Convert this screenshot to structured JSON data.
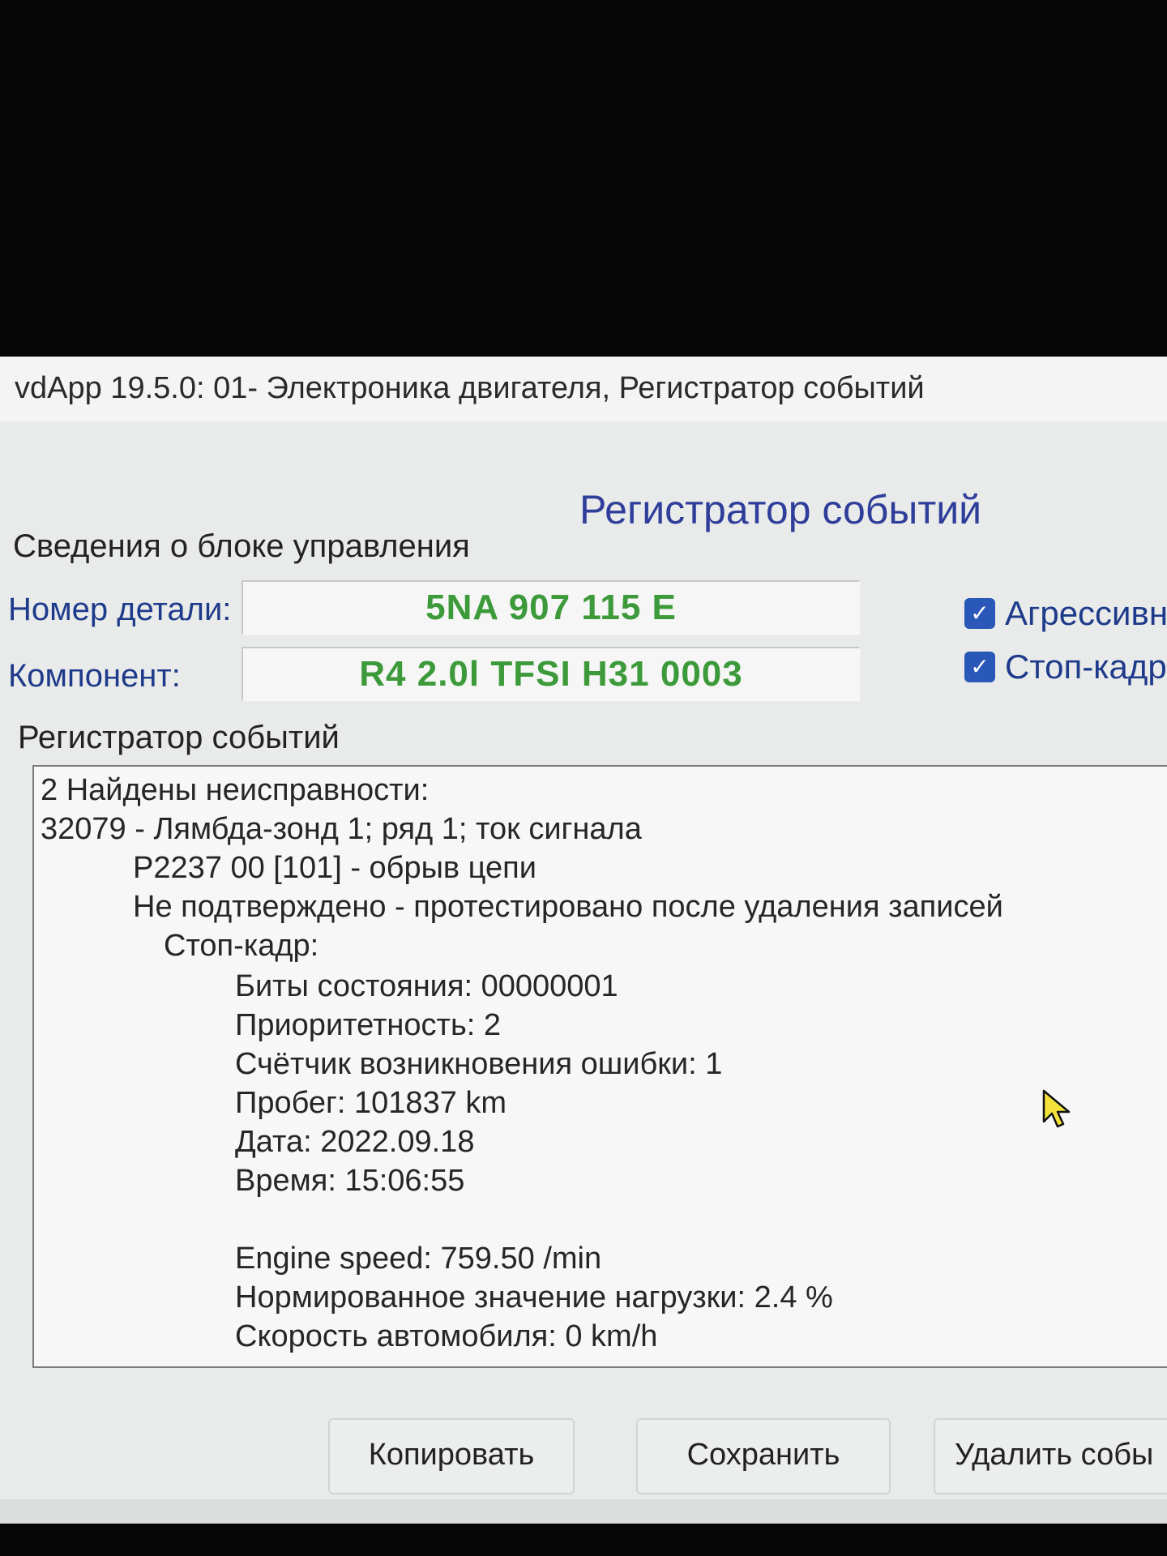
{
  "window": {
    "title": "vdApp 19.5.0: 01- Электроника двигателя,  Регистратор событий"
  },
  "dialog": {
    "heading": "Регистратор событий"
  },
  "ecu_info": {
    "section_label": "Сведения о блоке управления",
    "part_number_label": "Номер детали:",
    "part_number_value": "5NA 907 115 E",
    "component_label": "Компонент:",
    "component_value": "R4 2.0l TFSI  H31 0003"
  },
  "options": {
    "aggressive_label": "Агрессивн",
    "aggressive_checked": true,
    "freeze_frame_label": "Стоп-кадр",
    "freeze_frame_checked": true
  },
  "event_log": {
    "section_label": "Регистратор событий",
    "lines": [
      "2 Найдены неисправности:",
      "32079 - Лямбда-зонд 1; ряд 1; ток сигнала",
      "P2237 00 [101] - обрыв цепи",
      "Не подтверждено - протестировано после удаления записей",
      "Стоп-кадр:",
      "Биты состояния: 00000001",
      "Приоритетность: 2",
      "Счётчик возникновения ошибки: 1",
      "Пробег: 101837 km",
      "Дата: 2022.09.18",
      "Время: 15:06:55",
      "Engine speed: 759.50 /min",
      "Нормированное значение нагрузки: 2.4 %",
      "Скорость автомобиля: 0 km/h"
    ]
  },
  "buttons": {
    "copy_label": "Копировать",
    "save_label": "Сохранить",
    "delete_label": "Удалить собы"
  },
  "icons": {
    "checkbox": "check-icon",
    "cursor": "mouse-cursor-icon"
  },
  "colors": {
    "field_value": "#3d9a3a",
    "label_blue": "#1e3a8a",
    "heading_blue": "#2f3e9a",
    "checkbox_blue": "#2a58b8"
  }
}
